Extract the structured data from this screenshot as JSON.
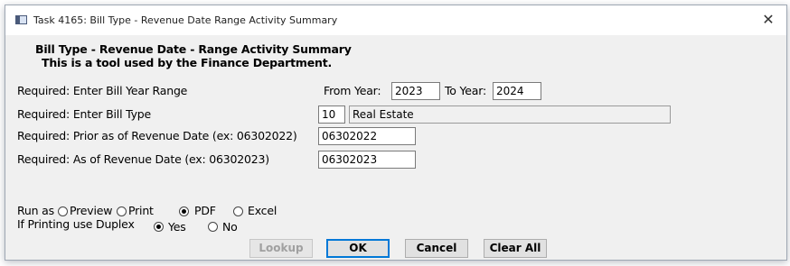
{
  "window": {
    "title": "Task 4165: Bill Type - Revenue Date Range Activity Summary",
    "icon": "app-window-icon",
    "close_glyph": "✕"
  },
  "header": {
    "title": "Bill Type - Revenue Date - Range Activity Summary",
    "subtitle": "This is a tool used by the Finance Department."
  },
  "form": {
    "year_range": {
      "label": "Required: Enter Bill Year Range",
      "from_label": "From Year:",
      "from_value": "2023",
      "to_label": "To Year:",
      "to_value": "2024"
    },
    "bill_type": {
      "label": "Required: Enter Bill Type",
      "code": "10",
      "description": "Real Estate"
    },
    "prior_date": {
      "label": "Required: Prior as of Revenue Date (ex: 06302022)",
      "value": "06302022"
    },
    "as_of_date": {
      "label": "Required: As of Revenue Date (ex: 06302023)",
      "value": "06302023"
    }
  },
  "run_as": {
    "label": "Run as",
    "options": [
      "Preview",
      "Print",
      "PDF",
      "Excel"
    ],
    "selected": "PDF"
  },
  "duplex": {
    "label": "If Printing use Duplex",
    "options": [
      "Yes",
      "No"
    ],
    "selected": "Yes"
  },
  "buttons": {
    "lookup": "Lookup",
    "ok": "OK",
    "cancel": "Cancel",
    "clear_all": "Clear All"
  }
}
